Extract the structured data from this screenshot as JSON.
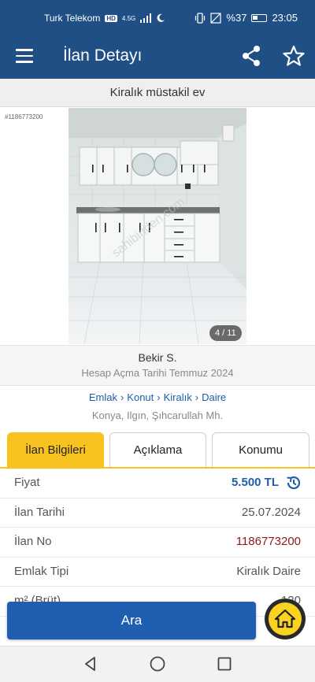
{
  "status_bar": {
    "carrier": "Turk Telekom",
    "network_badge": "HD",
    "network_type": "4.5G",
    "battery_percent": "%37",
    "time": "23:05"
  },
  "app_bar": {
    "title": "İlan Detayı",
    "icons": [
      "menu-icon",
      "share-icon",
      "star-icon"
    ]
  },
  "listing": {
    "subtitle": "Kiralık müstakil ev",
    "id_tag": "#1186773200",
    "photo_counter": "4 / 11"
  },
  "seller": {
    "name": "Bekir S.",
    "account_opened": "Hesap Açma Tarihi  Temmuz 2024"
  },
  "breadcrumb": [
    "Emlak",
    "Konut",
    "Kiralık",
    "Daire"
  ],
  "breadcrumb_separator": "›",
  "location": "Konya, Ilgın, Şıhcarullah Mh.",
  "tabs": [
    {
      "label": "İlan Bilgileri",
      "active": true
    },
    {
      "label": "Açıklama",
      "active": false
    },
    {
      "label": "Konumu",
      "active": false
    }
  ],
  "info_rows": [
    {
      "label": "Fiyat",
      "value": "5.500 TL"
    },
    {
      "label": "İlan Tarihi",
      "value": "25.07.2024"
    },
    {
      "label": "İlan No",
      "value": "1186773200"
    },
    {
      "label": "Emlak Tipi",
      "value": "Kiralık Daire"
    },
    {
      "label": "m² (Brüt)",
      "value": "120"
    }
  ],
  "actions": {
    "call_label": "Ara"
  },
  "colors": {
    "primary": "#1f4f84",
    "accent": "#f9c31f",
    "price": "#1f5ea8",
    "listing_no": "#8b1a1a"
  }
}
